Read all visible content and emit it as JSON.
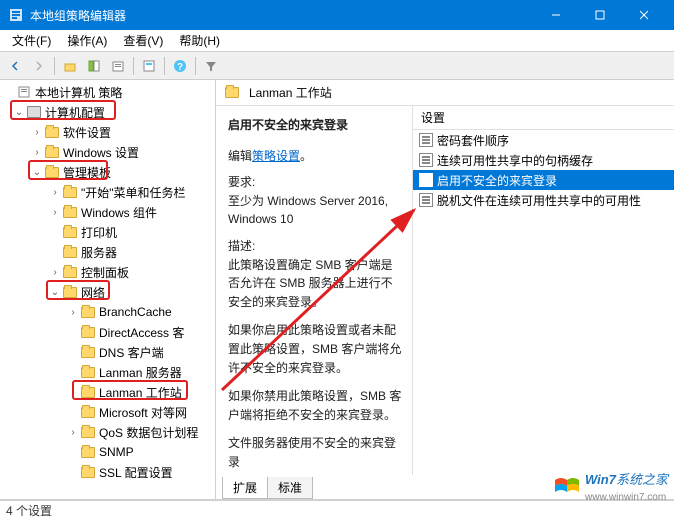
{
  "window": {
    "title": "本地组策略编辑器"
  },
  "menu": {
    "file": "文件(F)",
    "action": "操作(A)",
    "view": "查看(V)",
    "help": "帮助(H)"
  },
  "tree": {
    "root": "本地计算机 策略",
    "computer_config": "计算机配置",
    "software_settings": "软件设置",
    "windows_settings": "Windows 设置",
    "admin_templates": "管理模板",
    "start_taskbar": "\"开始\"菜单和任务栏",
    "windows_components": "Windows 组件",
    "printers": "打印机",
    "server": "服务器",
    "control_panel": "控制面板",
    "network": "网络",
    "branchcache": "BranchCache",
    "directaccess": "DirectAccess 客",
    "dns_client": "DNS 客户端",
    "lanman_server": "Lanman 服务器",
    "lanman_workstation": "Lanman 工作站",
    "microsoft_peer": "Microsoft 对等网",
    "qos": "QoS 数据包计划程",
    "snmp": "SNMP",
    "ssl": "SSL 配置设置"
  },
  "address": {
    "label": "Lanman 工作站"
  },
  "desc": {
    "heading": "启用不安全的来宾登录",
    "edit_label": "编辑",
    "edit_link": "策略设置",
    "req_label": "要求:",
    "req_value": "至少为 Windows Server 2016, Windows 10",
    "desc_label": "描述:",
    "p1": "此策略设置确定 SMB 客户端是否允许在 SMB 服务器上进行不安全的来宾登录。",
    "p2": "如果你启用此策略设置或者未配置此策略设置，SMB 客户端将允许不安全的来宾登录。",
    "p3": "如果你禁用此策略设置，SMB 客户端将拒绝不安全的来宾登录。",
    "p4": "文件服务器使用不安全的来宾登录"
  },
  "list": {
    "header": "设置",
    "items": [
      "密码套件顺序",
      "连续可用性共享中的句柄缓存",
      "启用不安全的来宾登录",
      "脱机文件在连续可用性共享中的可用性"
    ]
  },
  "tabs": {
    "extended": "扩展",
    "standard": "标准"
  },
  "status": {
    "text": "4 个设置"
  },
  "watermark": {
    "brand": "Win7",
    "text": "系统之家",
    "url": "www.winwin7.com"
  }
}
